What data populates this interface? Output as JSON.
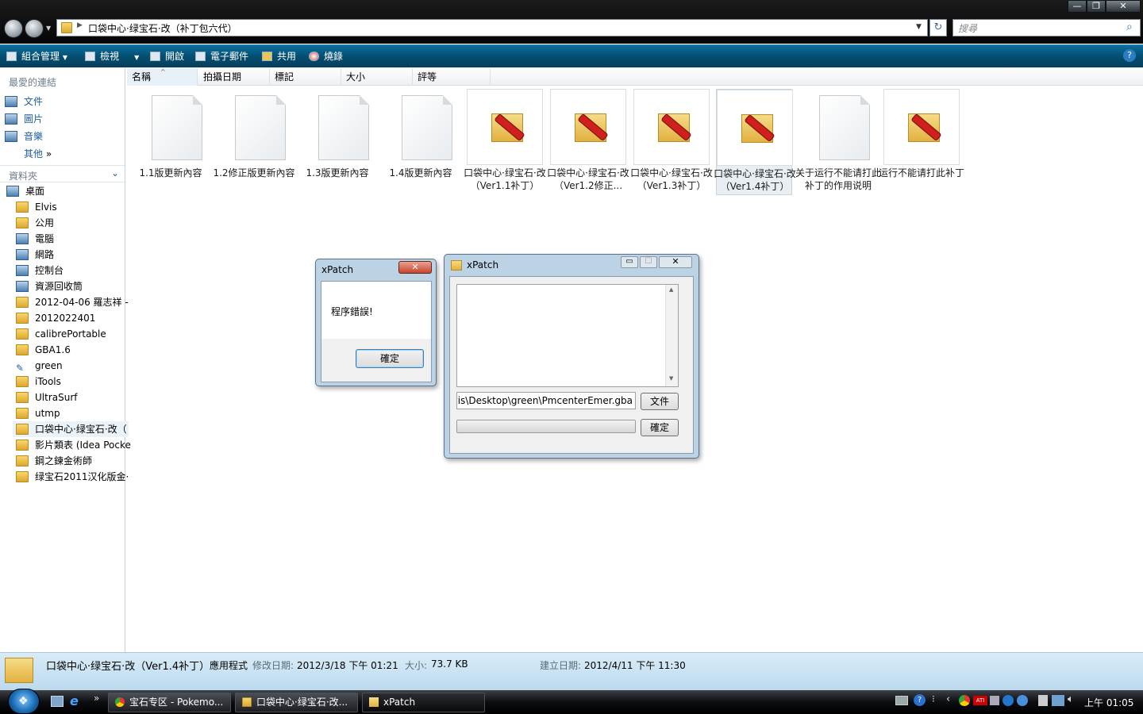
{
  "address": {
    "path": "口袋中心·绿宝石·改（补丁包六代）",
    "search_placeholder": "搜尋"
  },
  "toolbar": {
    "organize": "組合管理",
    "views": "檢視",
    "open": "開啟",
    "email": "電子郵件",
    "share": "共用",
    "burn": "燒錄"
  },
  "sidebar": {
    "favorites_header": "最愛的連結",
    "favorites": [
      "文件",
      "圖片",
      "音樂"
    ],
    "more": "其他",
    "more_chevron": "»",
    "folders_header": "資料夾",
    "folders": [
      "桌面",
      "Elvis",
      "公用",
      "電腦",
      "網路",
      "控制台",
      "資源回收筒",
      "2012-04-06 羅志祥 - ",
      "2012022401",
      "calibrePortable",
      "GBA1.6",
      "green",
      "iTools",
      "UltraSurf",
      "utmp",
      "口袋中心·绿宝石·改（",
      "影片類表 (Idea Pocke",
      "鋼之鍊金術師",
      "绿宝石2011汉化版金·"
    ]
  },
  "columns": [
    "名稱",
    "拍攝日期",
    "標記",
    "大小",
    "評等"
  ],
  "files": [
    {
      "name": "1.1版更新內容",
      "icon": "text-document-icon"
    },
    {
      "name": "1.2修正版更新內容",
      "icon": "text-document-icon"
    },
    {
      "name": "1.3版更新內容",
      "icon": "text-document-icon"
    },
    {
      "name": "1.4版更新內容",
      "icon": "text-document-icon"
    },
    {
      "name": "口袋中心·绿宝石·改（Ver1.1补丁）",
      "icon": "xpatch-app-icon"
    },
    {
      "name": "口袋中心·绿宝石·改（Ver1.2修正...",
      "icon": "xpatch-app-icon"
    },
    {
      "name": "口袋中心·绿宝石·改（Ver1.3补丁）",
      "icon": "xpatch-app-icon"
    },
    {
      "name": "口袋中心·绿宝石·改（Ver1.4补丁）",
      "icon": "xpatch-app-icon"
    },
    {
      "name": "关于运行不能请打此补丁的作用说明",
      "icon": "text-document-icon"
    },
    {
      "name": "运行不能请打此补丁",
      "icon": "xpatch-app-icon"
    }
  ],
  "error_dialog": {
    "title": "xPatch",
    "message": "程序錯誤!",
    "ok": "確定",
    "close": "✕"
  },
  "xpatch_window": {
    "title": "xPatch",
    "path_value": "Elvis\\Desktop\\green\\PmcenterEmer.gba",
    "file_button": "文件",
    "ok_button": "確定",
    "progress": 0
  },
  "details": {
    "name": "口袋中心·绿宝石·改（Ver1.4补丁）",
    "type": "應用程式",
    "modified_label": "修改日期:",
    "modified": "2012/3/18 下午 01:21",
    "size_label": "大小:",
    "size": "73.7 KB",
    "created_label": "建立日期:",
    "created": "2012/4/11 下午 11:30"
  },
  "taskbar": {
    "tasks": [
      "宝石专区 - Pokemo...",
      "口袋中心·绿宝石·改...",
      "xPatch"
    ],
    "clock": "上午 01:05",
    "chevron": "»",
    "tray_chevron": "‹"
  },
  "colors": {
    "toolbar": "#064f72",
    "details": "#cfe5f3",
    "taskbar": "#0c0d10"
  }
}
